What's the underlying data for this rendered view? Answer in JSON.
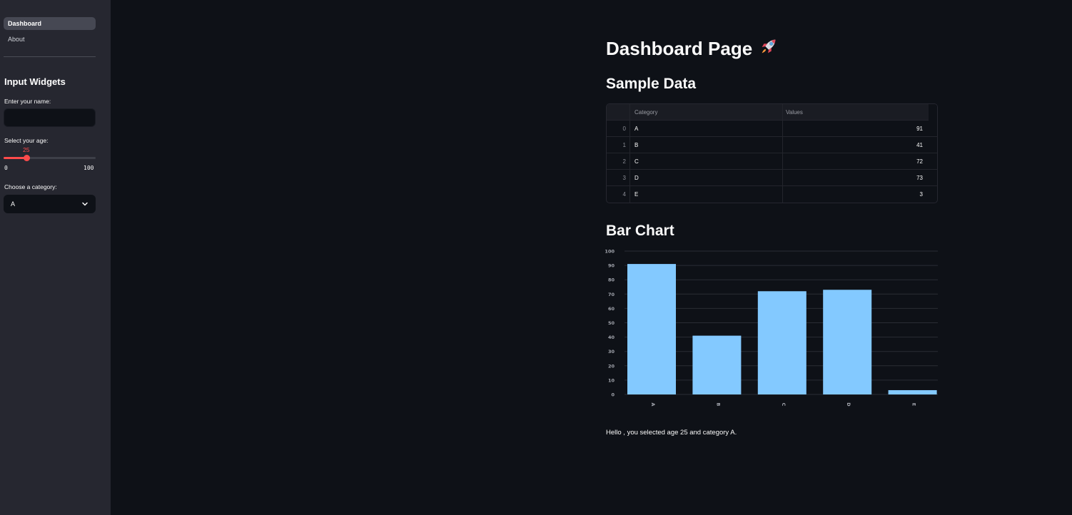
{
  "sidebar": {
    "nav": [
      {
        "label": "Dashboard",
        "active": true
      },
      {
        "label": "About",
        "active": false
      }
    ],
    "heading": "Input Widgets",
    "name_label": "Enter your name:",
    "name_value": "",
    "age_label": "Select your age:",
    "age_value": "25",
    "age_min": "0",
    "age_max": "100",
    "age_fraction": 0.25,
    "category_label": "Choose a category:",
    "category_value": "A"
  },
  "main": {
    "title": "Dashboard Page",
    "title_icon": "rocket-icon",
    "table_title": "Sample Data",
    "chart_title": "Bar Chart",
    "result_text": "Hello , you selected age 25 and category A."
  },
  "table": {
    "columns": [
      "",
      "Category",
      "Values"
    ],
    "rows": [
      {
        "index": "0",
        "category": "A",
        "value": "91"
      },
      {
        "index": "1",
        "category": "B",
        "value": "41"
      },
      {
        "index": "2",
        "category": "C",
        "value": "72"
      },
      {
        "index": "3",
        "category": "D",
        "value": "73"
      },
      {
        "index": "4",
        "category": "E",
        "value": "3"
      }
    ]
  },
  "colors": {
    "accent": "#ff4b4b",
    "bar": "#83c9ff",
    "background": "#0e1117",
    "sidebar": "#262730"
  },
  "chart_data": {
    "type": "bar",
    "categories": [
      "A",
      "B",
      "C",
      "D",
      "E"
    ],
    "values": [
      91,
      41,
      72,
      73,
      3
    ],
    "ylim": [
      0,
      100
    ],
    "yticks": [
      0,
      10,
      20,
      30,
      40,
      50,
      60,
      70,
      80,
      90,
      100
    ],
    "grid": true,
    "title": "",
    "xlabel": "",
    "ylabel": ""
  }
}
